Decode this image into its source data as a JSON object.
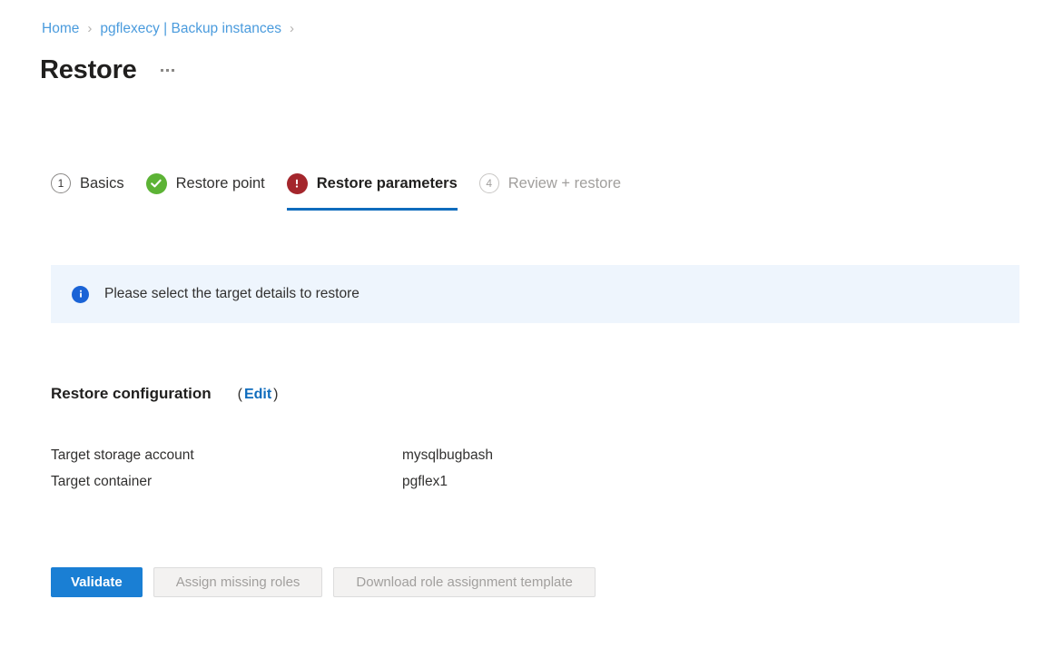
{
  "breadcrumb": {
    "items": [
      {
        "label": "Home"
      },
      {
        "label": "pgflexecy | Backup instances"
      }
    ],
    "separator": "›"
  },
  "header": {
    "title": "Restore",
    "more_menu_name": "more-options"
  },
  "wizard": {
    "steps": [
      {
        "label": "Basics",
        "marker": "1",
        "state": "todo"
      },
      {
        "label": "Restore point",
        "marker": "✓",
        "state": "complete"
      },
      {
        "label": "Restore parameters",
        "marker": "!",
        "state": "error-active"
      },
      {
        "label": "Review + restore",
        "marker": "4",
        "state": "disabled"
      }
    ]
  },
  "notification": {
    "icon": "info-icon",
    "message": "Please select the target details to restore"
  },
  "restore_configuration": {
    "title": "Restore configuration",
    "edit_open_paren": "(",
    "edit_label": "Edit",
    "edit_close_paren": ")",
    "rows": [
      {
        "label": "Target storage account",
        "value": "mysqlbugbash"
      },
      {
        "label": "Target container",
        "value": "pgflex1"
      }
    ]
  },
  "actions": {
    "validate": "Validate",
    "assign_missing_roles": "Assign missing roles",
    "download_role_assignment_template": "Download role assignment template"
  },
  "colors": {
    "accent": "#0f6cbd",
    "primary_button": "#1a7fd4",
    "link": "#4a9bdd",
    "success": "#5cb335",
    "error": "#a4262c",
    "info": "#1a63d6",
    "banner_bg": "#eef5fd"
  }
}
